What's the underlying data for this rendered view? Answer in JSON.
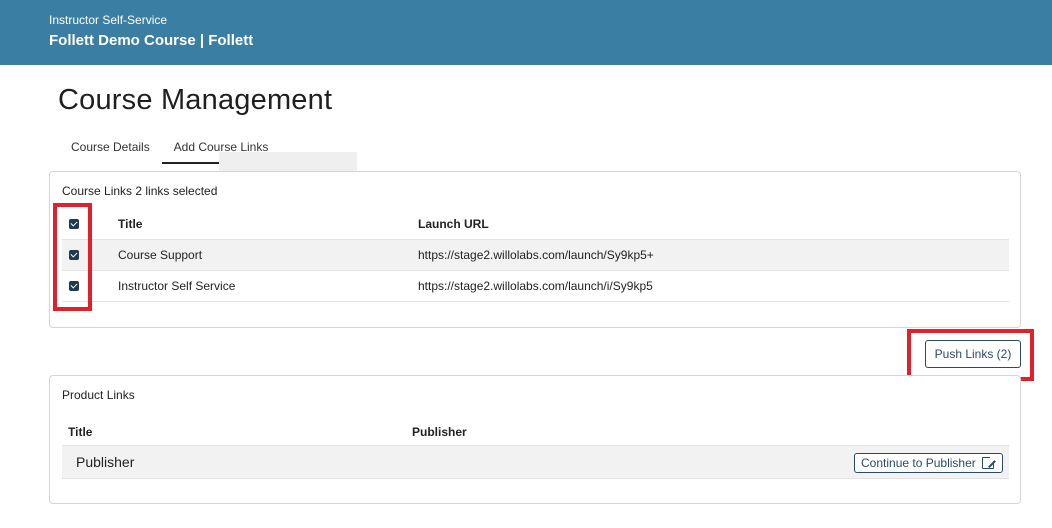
{
  "header": {
    "subtitle": "Instructor Self-Service",
    "title": "Follett Demo Course | Follett"
  },
  "page": {
    "title": "Course Management"
  },
  "tabs": [
    {
      "label": "Course Details",
      "active": false
    },
    {
      "label": "Add Course Links",
      "active": true
    }
  ],
  "course_links": {
    "heading": "Course Links 2 links selected",
    "columns": {
      "title": "Title",
      "url": "Launch URL"
    },
    "rows": [
      {
        "checked": true,
        "title": "Course Support",
        "url": "https://stage2.willolabs.com/launch/Sy9kp5+"
      },
      {
        "checked": true,
        "title": "Instructor Self Service",
        "url": "https://stage2.willolabs.com/launch/i/Sy9kp5"
      }
    ],
    "push_button": "Push Links (2)"
  },
  "product_links": {
    "heading": "Product Links",
    "columns": {
      "title": "Title",
      "publisher": "Publisher"
    },
    "rows": [
      {
        "title": "Publisher",
        "action": "Continue to Publisher"
      }
    ]
  },
  "colors": {
    "header_bg": "#3a7fa3",
    "highlight": "#e0202a",
    "button": "#2b4a66"
  },
  "icons": {
    "checkbox": "checkbox-checked-icon",
    "external": "external-link-icon"
  }
}
